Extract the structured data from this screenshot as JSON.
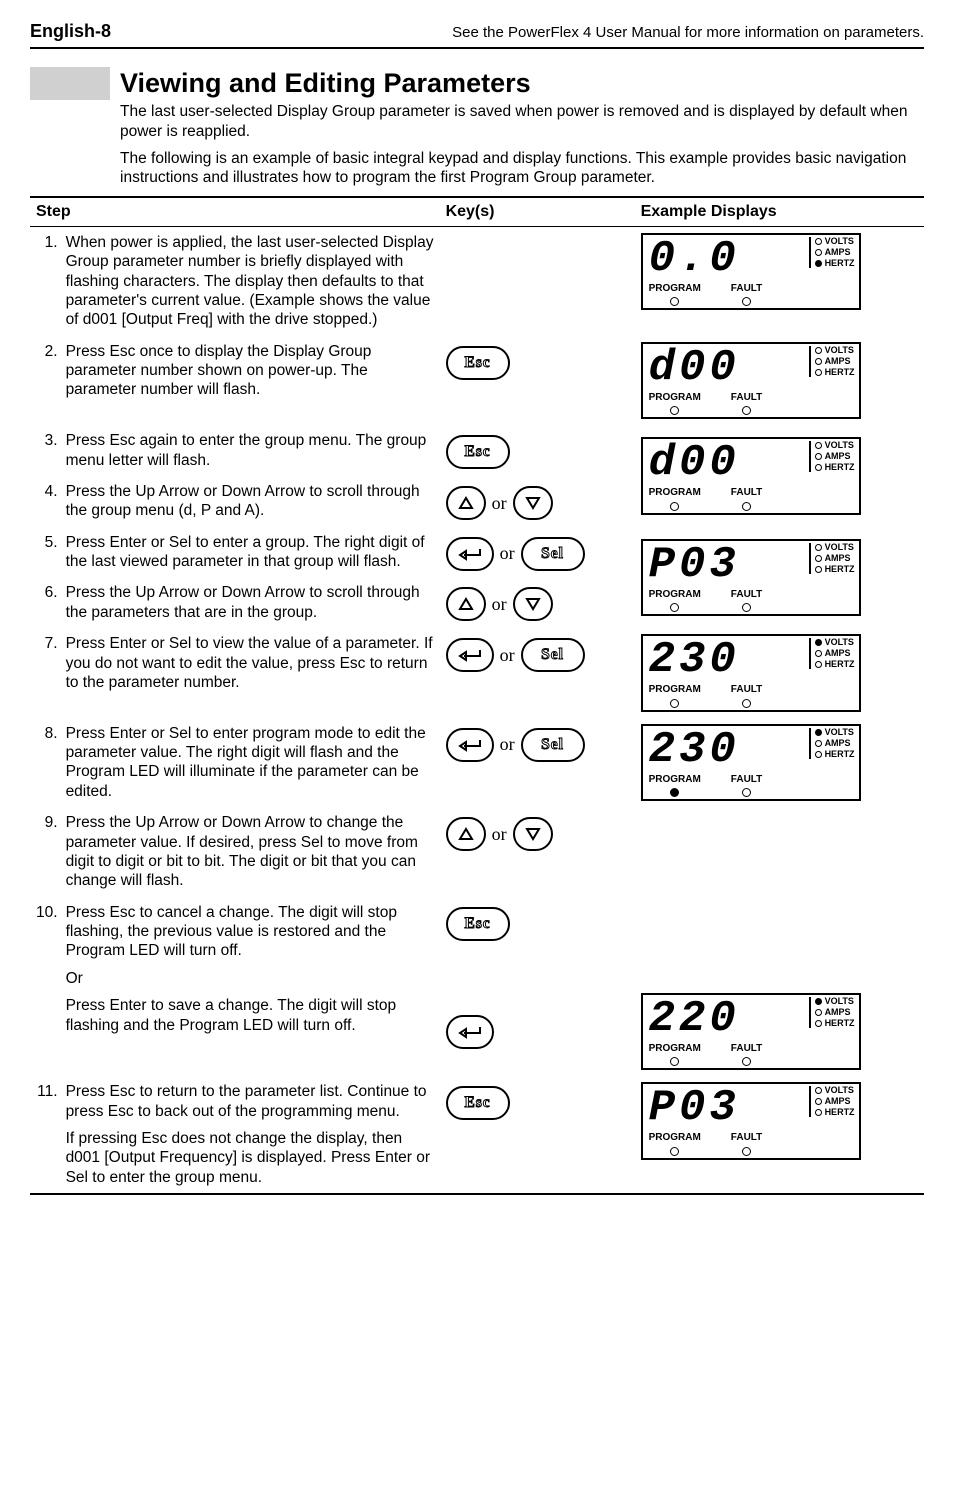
{
  "header": {
    "left": "English-8",
    "right": "See the PowerFlex 4 User Manual for more information on parameters."
  },
  "title": "Viewing and Editing Parameters",
  "intro1": "The last user-selected Display Group parameter is saved when power is removed and is displayed by default when power is reapplied.",
  "intro2": "The following is an example of basic integral keypad and display functions. This example provides basic navigation instructions and illustrates how to program the first Program Group parameter.",
  "th": {
    "step": "Step",
    "key": "Key(s)",
    "disp": "Example Displays"
  },
  "keys": {
    "esc": "Esc",
    "sel": "Sel",
    "or": "or"
  },
  "ind": {
    "volts": "VOLTS",
    "amps": "AMPS",
    "hertz": "HERTZ",
    "program": "PROGRAM",
    "fault": "FAULT"
  },
  "rows": {
    "r1": {
      "n": "1.",
      "t": "When power is applied, the last user-selected Display Group parameter number is briefly displayed with flashing characters. The display then defaults to that parameter's current value. (Example shows the value of d001 [Output Freq] with the drive stopped.)",
      "seg": "0.0"
    },
    "r2": {
      "n": "2.",
      "t": "Press Esc once to display the Display Group parameter number shown on power-up. The parameter number will flash.",
      "seg": "d00"
    },
    "r3": {
      "n": "3.",
      "t": "Press Esc again to enter the group menu. The group menu letter will flash.",
      "seg": "d00"
    },
    "r4": {
      "n": "4.",
      "t": "Press the Up Arrow or Down Arrow to scroll through the group menu (d, P and A)."
    },
    "r5": {
      "n": "5.",
      "t": "Press Enter or Sel to enter a group. The right digit of the last viewed parameter in that group will flash.",
      "seg": "P03"
    },
    "r6": {
      "n": "6.",
      "t": "Press the Up Arrow or Down Arrow to scroll through the parameters that are in the group."
    },
    "r7": {
      "n": "7.",
      "t": "Press Enter or Sel to view the value of a parameter. If you do not want to edit the value, press Esc to return to the parameter number.",
      "seg": "230"
    },
    "r8": {
      "n": "8.",
      "t": "Press Enter or Sel to enter program mode to edit the parameter value. The right digit will flash and the Program LED will illuminate if the parameter can be edited.",
      "seg": "230"
    },
    "r9": {
      "n": "9.",
      "t": "Press the Up Arrow or Down Arrow to change the parameter value. If desired, press Sel to move from digit to digit or bit to bit. The digit or bit that you can change will flash."
    },
    "r10a": {
      "n": "10.",
      "t": "Press Esc to cancel a change. The digit will stop flashing, the previous value is restored and the Program LED will turn off."
    },
    "r10or": {
      "t": "Or"
    },
    "r10b": {
      "t": "Press Enter to save a change. The digit will stop flashing and the Program LED will turn off.",
      "seg": "220"
    },
    "r11a": {
      "n": "11.",
      "t": "Press Esc to return to the parameter list. Continue to press Esc to back out of the programming menu.",
      "seg": "P03"
    },
    "r11b": {
      "t": "If pressing Esc does not change the display, then d001 [Output Frequency] is displayed. Press Enter or Sel to enter the group menu."
    }
  }
}
